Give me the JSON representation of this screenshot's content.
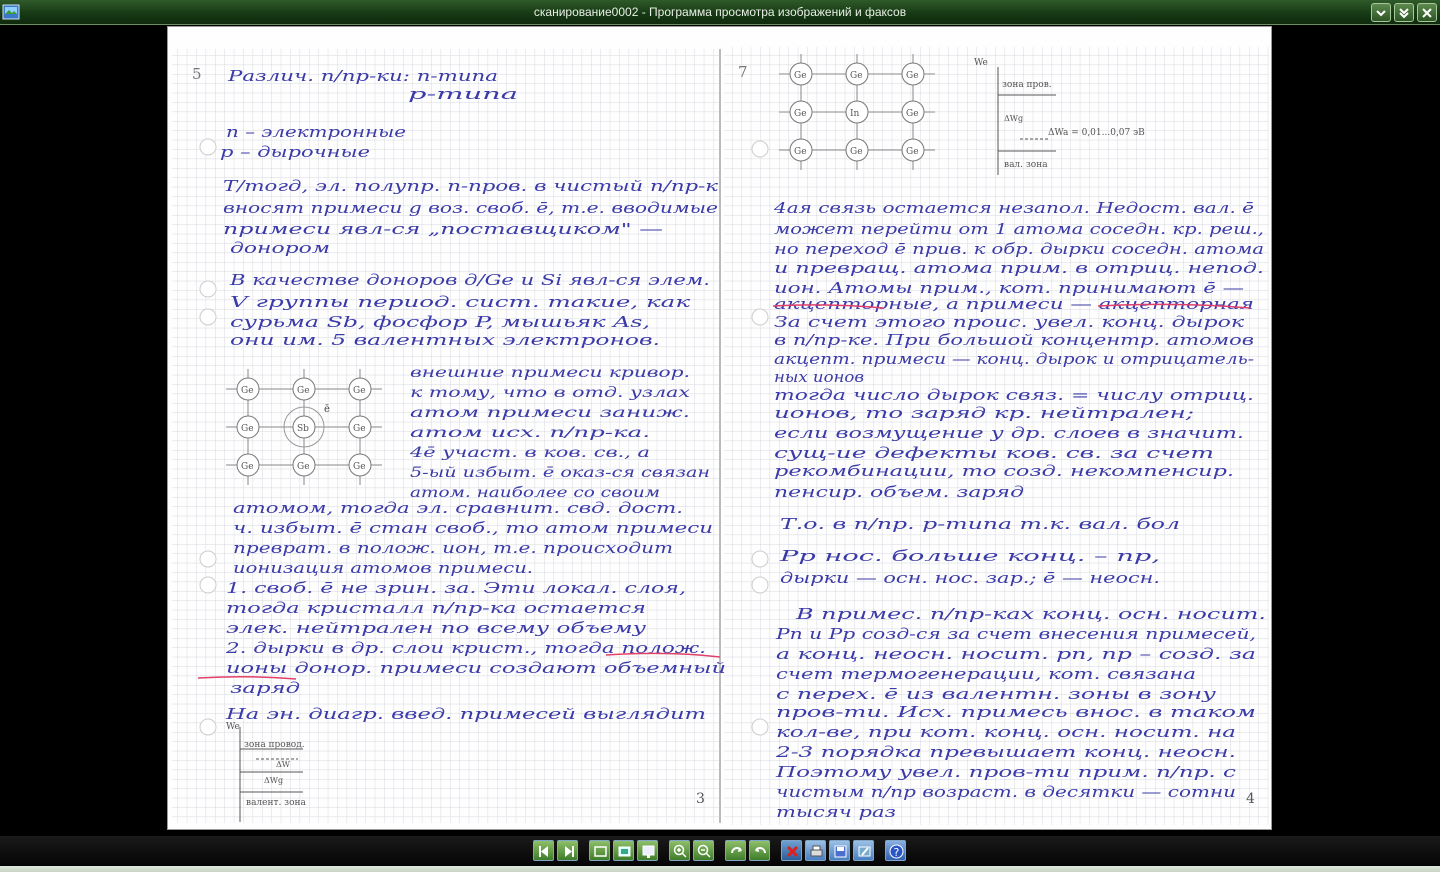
{
  "window": {
    "title": "сканирование0002 - Программа просмотра изображений и факсов",
    "icon": "image-viewer-icon"
  },
  "window_controls": [
    {
      "name": "minimize-button",
      "icon": "chevron-down-icon"
    },
    {
      "name": "restore-button",
      "icon": "double-chevron-icon"
    },
    {
      "name": "close-button",
      "icon": "close-icon"
    }
  ],
  "scan": {
    "left_page": {
      "number_top": "5",
      "page_number": "3",
      "lines": [
        "Различ. п/пр-ки: n-типа",
        "p-типа",
        "n – электронные",
        "p – дырочные",
        "Т/тогд, эл. полупр. n-пров. в чистый п/пр-к",
        "вносят примеси g воз. своб. ē, т.е. вводимые",
        "примеси явл-ся „поставщиком\" —",
        "донором",
        "В качестве доноров д/Ge и Si явл-ся элем.",
        "V группы период. сист. такие, как",
        "сурьма Sb, фосфор P, мышьяк As,",
        "они им. 5 валентных электронов.",
        "внешние примеси кривор.",
        "к тому, что в отд. узлах",
        "атом примеси заниж.",
        "атом исх. п/пр-ка.",
        "4ē участ. в ков. св., а",
        "5-ый избыт. ē оказ-ся связан",
        "атом. наиболее со своим",
        "атомом, тогда эл. сравнит. свд. дост.",
        "ч. избыт. ē стан своб., то атом примеси",
        "преврат. в полож. ион, т.е. происходит",
        "ионизация атомов примеси.",
        "1. своб. ē не зрин. за. Эти локал. слоя,",
        "тогда кристалл п/пр-ка остается",
        "элек. нейтрален по всему объему",
        "2. дырки в др. слои крист., тогда полож.",
        "ионы донор. примеси создают объемный",
        "заряд",
        "На эн. диагр. введ. примесей выглядит"
      ],
      "atom_labels": [
        "Ge",
        "Ge",
        "Ge",
        "Ge",
        "Sb",
        "Ge",
        "Ge",
        "Ge",
        "Ge",
        "ē"
      ],
      "band_labels": [
        "We",
        "зона провод.",
        "ΔW",
        "ΔWg",
        "валент. зона"
      ]
    },
    "right_page": {
      "number_top": "7",
      "page_number": "4",
      "lines": [
        "4ая связь остается незапол. Недост. вал. ē",
        "может перейти от 1 атома соседн. кр. реш.,",
        "но переход ē прив. к обр. дырки соседн. атома",
        "и превращ. атома прим. в отриц. непод.",
        "ион. Атомы прим., кот. принимают ē —",
        "акцепторные, а примеси — акцепторная",
        "За счет этого проис. увел. конц. дырок",
        "в п/пр-ке. При большой концентр. атомов",
        "акцепт. примеси — конц. дырок и отрицатель-",
        "ных ионов",
        "тогда число дырок связ. = числу отриц.",
        "ионов, то заряд кр. нейтрален;",
        "если возмущение у др. слоев в значит.",
        "сущ-ие дефекты ков. св. за счет",
        "рекомбинации, то созд. некомпенсир.",
        "пенсир. объем. заряд",
        "Т.о. в п/пр. p-типа т.к. вал. бол",
        "Pp нос. больше конц. – np,",
        "дырки — осн. нос. зар.; ē — неосн.",
        "В примес. п/пр-ках конц. осн. носит.",
        "Pn и Pp созд-ся за счет внесения примесей,",
        "а конц. неосн. носит. pn, np – созд. за",
        "счет термогенерации, кот. связана",
        "с перех. ē из валентн. зоны в зону",
        "пров-ти. Исх. примесь внос. в таком",
        "кол-ве, при кот. конц. осн. носит. на",
        "2-3 порядка превышает конц. неосн.",
        "Поэтому увел. пров-ти прим. п/пр. с",
        "чистым п/пр возраст. в десятки — сотни",
        "тысяч раз"
      ],
      "atom_labels": [
        "Ge",
        "Ge",
        "Ge",
        "Ge",
        "In",
        "Ge",
        "Ge",
        "Ge",
        "Ge"
      ],
      "band_labels": [
        "We",
        "зона пров.",
        "ΔWg",
        "ΔWa = 0,01...0,07 эВ",
        "вал. зона"
      ]
    }
  },
  "toolbar": [
    {
      "name": "previous-image-button",
      "icon": "previous-image-icon"
    },
    {
      "name": "next-image-button",
      "icon": "next-image-icon"
    },
    {
      "name": "best-fit-button",
      "icon": "best-fit-icon"
    },
    {
      "name": "actual-size-button",
      "icon": "actual-size-icon"
    },
    {
      "name": "slideshow-button",
      "icon": "slideshow-icon"
    },
    {
      "name": "zoom-in-button",
      "icon": "zoom-in-icon"
    },
    {
      "name": "zoom-out-button",
      "icon": "zoom-out-icon"
    },
    {
      "name": "rotate-clockwise-button",
      "icon": "rotate-clockwise-icon"
    },
    {
      "name": "rotate-counterclockwise-button",
      "icon": "rotate-counterclockwise-icon"
    },
    {
      "name": "delete-button",
      "icon": "delete-icon"
    },
    {
      "name": "print-button",
      "icon": "print-icon"
    },
    {
      "name": "save-button",
      "icon": "save-icon"
    },
    {
      "name": "open-editor-button",
      "icon": "edit-image-icon"
    },
    {
      "name": "help-button",
      "icon": "help-icon"
    }
  ]
}
